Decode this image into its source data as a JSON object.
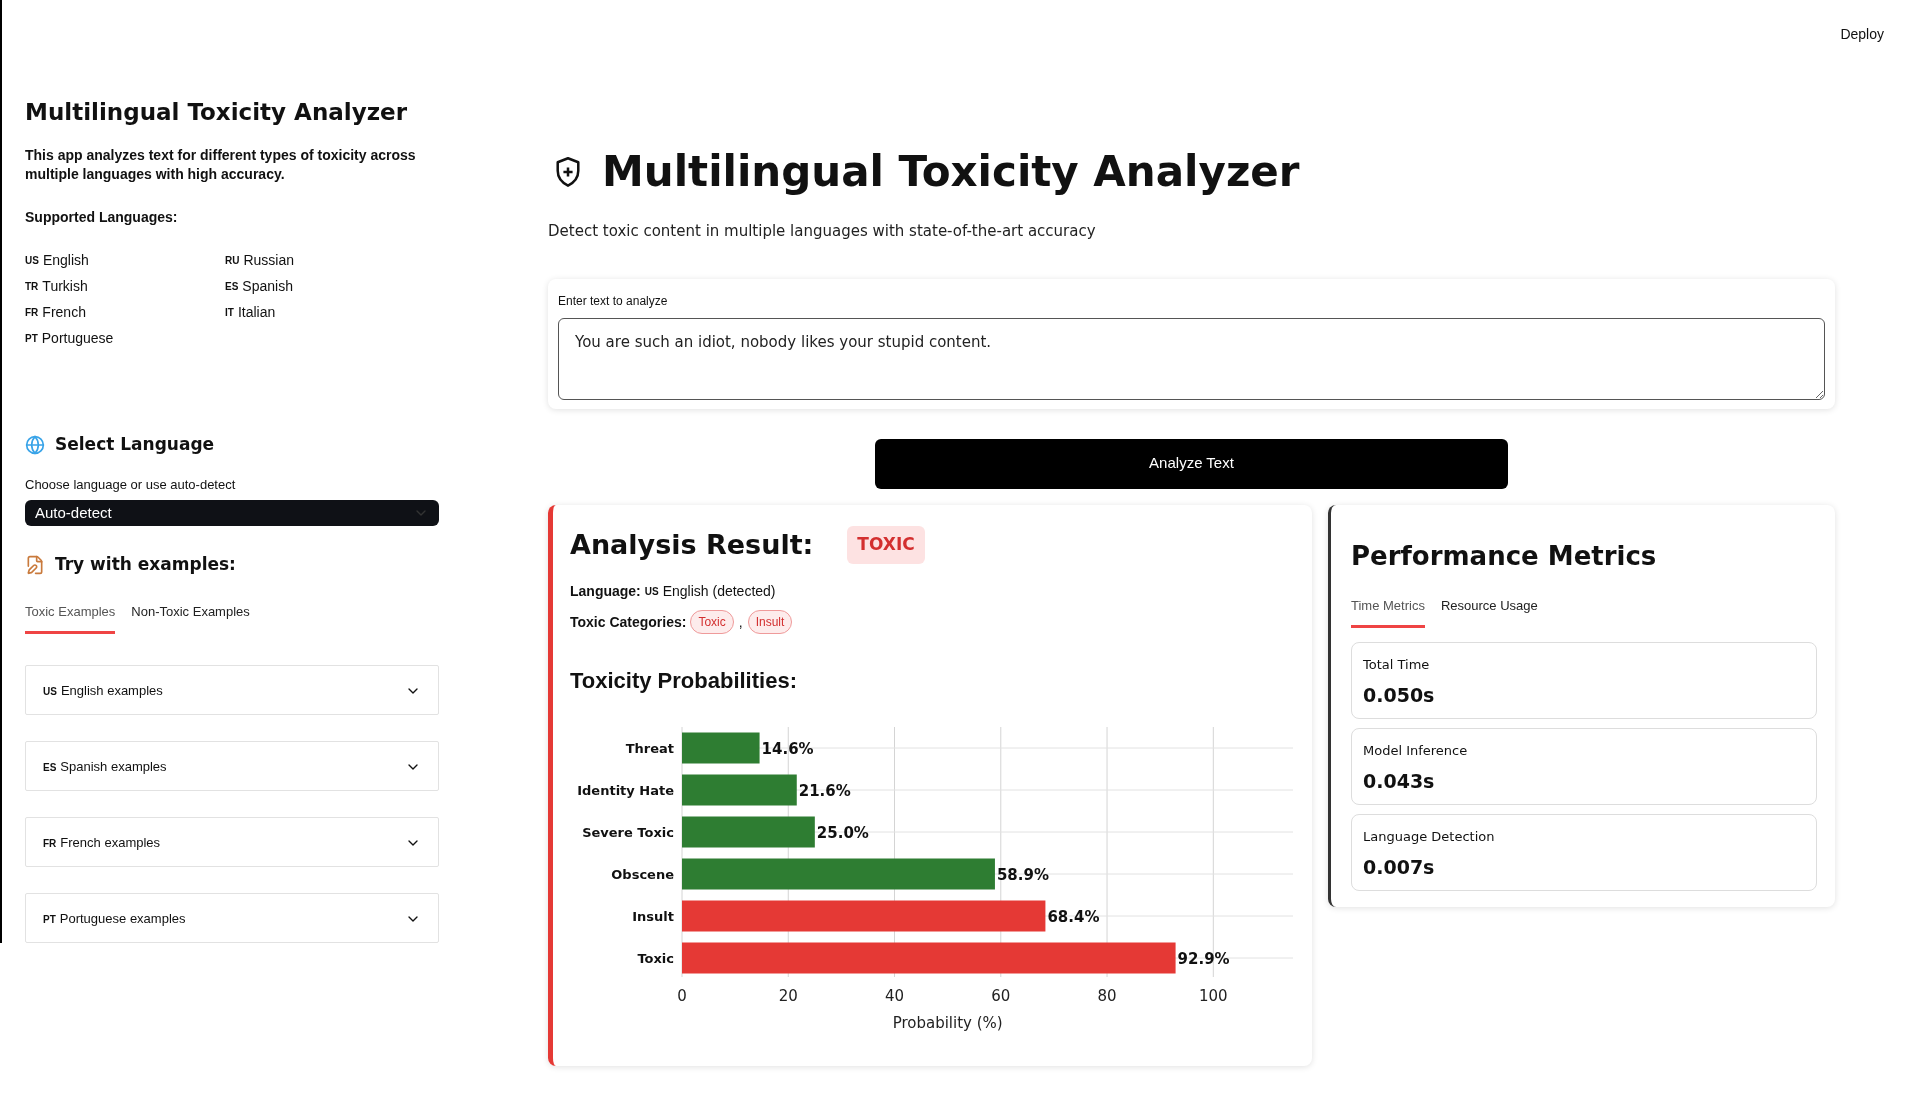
{
  "header": {
    "deploy": "Deploy"
  },
  "sidebar": {
    "title": "Multilingual Toxicity Analyzer",
    "description": "This app analyzes text for different types of toxicity across multiple languages with high accuracy.",
    "languages_heading": "Supported Languages:",
    "languages": [
      {
        "flag": "US",
        "name": "English"
      },
      {
        "flag": "RU",
        "name": "Russian"
      },
      {
        "flag": "TR",
        "name": "Turkish"
      },
      {
        "flag": "ES",
        "name": "Spanish"
      },
      {
        "flag": "FR",
        "name": "French"
      },
      {
        "flag": "IT",
        "name": "Italian"
      },
      {
        "flag": "PT",
        "name": "Portuguese"
      }
    ],
    "select_heading": "Select Language",
    "select_label": "Choose language or use auto-detect",
    "select_value": "Auto-detect",
    "examples_heading": "Try with examples:",
    "tabs": [
      {
        "label": "Toxic Examples",
        "selected": true
      },
      {
        "label": "Non-Toxic Examples",
        "selected": false
      }
    ],
    "accordions": [
      {
        "flag": "US",
        "label": "English examples",
        "expanded": false
      },
      {
        "flag": "ES",
        "label": "Spanish examples",
        "expanded": false
      },
      {
        "flag": "FR",
        "label": "French examples",
        "expanded": false
      },
      {
        "flag": "PT",
        "label": "Portuguese examples",
        "expanded": false
      }
    ]
  },
  "main": {
    "title": "Multilingual Toxicity Analyzer",
    "subtitle": "Detect toxic content in multiple languages with state-of-the-art accuracy",
    "input": {
      "label": "Enter text to analyze",
      "value": "You are such an idiot, nobody likes your stupid content."
    },
    "analyze_button": "Analyze Text",
    "result": {
      "title": "Analysis Result:",
      "verdict": "TOXIC",
      "language_label": "Language:",
      "language_flag": "US",
      "language_value": "English (detected)",
      "categories_label": "Toxic Categories:",
      "categories": [
        "Toxic",
        "Insult"
      ],
      "category_separator": ",",
      "chart_heading": "Toxicity Probabilities:",
      "chart_data": {
        "type": "bar",
        "orientation": "horizontal",
        "xlabel": "Probability (%)",
        "categories": [
          "Threat",
          "Identity Hate",
          "Severe Toxic",
          "Obscene",
          "Insult",
          "Toxic"
        ],
        "series": [
          {
            "color": "#2e7d32",
            "values": [
              14.6,
              21.6,
              25.0,
              58.9,
              null,
              null
            ]
          },
          {
            "color": "#e53935",
            "values": [
              null,
              null,
              null,
              null,
              68.4,
              92.9
            ]
          }
        ],
        "value_labels": [
          "14.6%",
          "21.6%",
          "25.0%",
          "58.9%",
          "68.4%",
          "92.9%"
        ],
        "xlim": [
          0,
          115
        ],
        "grid": true,
        "xticks": [
          0,
          20,
          40,
          60,
          80,
          100
        ]
      }
    },
    "metrics": {
      "title": "Performance Metrics",
      "tabs": [
        {
          "label": "Time Metrics",
          "selected": true
        },
        {
          "label": "Resource Usage",
          "selected": false
        }
      ],
      "items": [
        {
          "label": "Total Time",
          "value": "0.050s"
        },
        {
          "label": "Model Inference",
          "value": "0.043s"
        },
        {
          "label": "Language Detection",
          "value": "0.007s"
        }
      ]
    }
  }
}
